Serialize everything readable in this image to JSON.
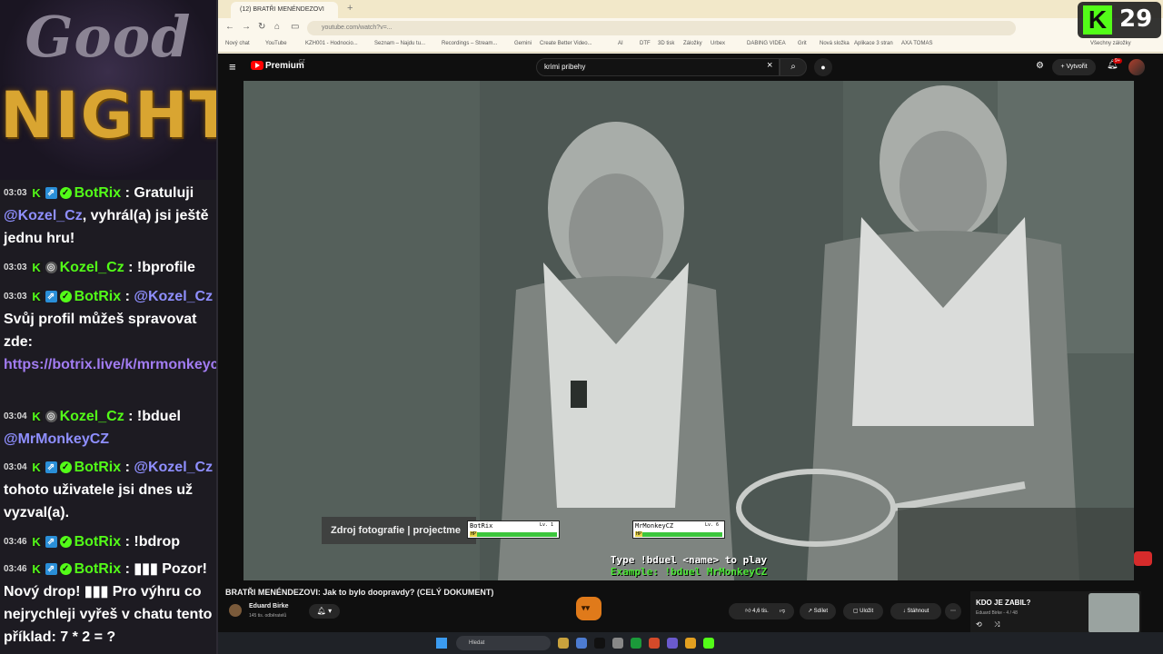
{
  "overlay": {
    "banner_line1": "Good",
    "banner_line2": "NIGHT",
    "kick_count": "29",
    "kick_logo": "K"
  },
  "chat": [
    {
      "time": "03:03",
      "user": "BotRix",
      "parts": [
        "Gratuluji ",
        "@Kozel_Cz",
        ", vyhrál(a) jsi ještě jednu hru!"
      ],
      "kinds": [
        "text",
        "mention",
        "text"
      ]
    },
    {
      "time": "03:03",
      "user": "Kozel_Cz",
      "parts": [
        "!bprofile"
      ],
      "kinds": [
        "text"
      ]
    },
    {
      "time": "03:03",
      "user": "BotRix",
      "parts": [
        "@Kozel_Cz",
        " Svůj profil můžeš spravovat zde: ",
        "https://botrix.live/k/mrmonkeycz/battle"
      ],
      "kinds": [
        "mention",
        "text",
        "link"
      ]
    },
    {
      "time": "03:04",
      "user": "Kozel_Cz",
      "parts": [
        "!bduel ",
        "@MrMonkeyCZ"
      ],
      "kinds": [
        "text",
        "mention"
      ]
    },
    {
      "time": "03:04",
      "user": "BotRix",
      "parts": [
        "@Kozel_Cz",
        " tohoto uživatele jsi dnes už vyzval(a)."
      ],
      "kinds": [
        "mention",
        "text"
      ]
    },
    {
      "time": "03:46",
      "user": "BotRix",
      "parts": [
        "!bdrop"
      ],
      "kinds": [
        "text"
      ]
    },
    {
      "time": "03:46",
      "user": "BotRix",
      "parts": [
        "▮▮▮ Pozor! Nový drop! ",
        "▮▮▮",
        " Pro výhru co nejrychleji vyřeš v chatu tento příklad: 7 * 2 = ?"
      ],
      "kinds": [
        "text",
        "text",
        "text"
      ]
    }
  ],
  "browser": {
    "tab_title": "(12) BRATŘI MENÉNDEZOVI",
    "url": "youtube.com/watch?v=..."
  },
  "bookmarks": [
    "Nový chat",
    "YouTube",
    "KZH001 - Hodnocio...",
    "Seznam – Najdu tu...",
    "Recordings – Stream...",
    "Gemini",
    "Create Better Video...",
    "AI",
    "DTF",
    "3D tisk",
    "Záložky",
    "Urbex",
    "DABING VIDEA",
    "Grit",
    "Nová složka",
    "Aplikace 3 stran",
    "AXA TOMAS",
    "Všechny záložky"
  ],
  "youtube": {
    "brand": "Premium",
    "brand_region": "CZ",
    "search_value": "krimi pribehy",
    "create_label": "Vytvořit",
    "notif_badge": "9+",
    "video_title": "BRATŘI MENÉNDEZOVI: Jak to bylo doopravdy? (CELÝ DOKUMENT)",
    "channel_name": "Eduard Birke",
    "channel_subs": "145 tis. odběratelů",
    "likes": "4,6 tis.",
    "share_label": "Sdílet",
    "save_label": "Uložit",
    "download_label": "Stáhnout",
    "playlist_title": "KDO JE ZABIL?",
    "playlist_sub": "Eduard Birke - 4 / 48"
  },
  "video_overlay": {
    "source_caption": "Zdroj fotografie | projectme",
    "player1_name": "BotRix",
    "player1_level": "Lv. 1",
    "player1_hp": 1.0,
    "player2_name": "MrMonkeyCZ",
    "player2_level": "Lv. 6",
    "player2_hp": 1.0,
    "hp_label": "HP",
    "duel_instruction": "Type !bduel <name> to play",
    "duel_example": "Example: !bduel MrMonkeyCZ"
  },
  "taskbar": {
    "search_placeholder": "Hledat"
  },
  "colors": {
    "kick_green": "#53fc18",
    "youtube_red": "#ff0000",
    "banner_gold": "#d9a531"
  }
}
